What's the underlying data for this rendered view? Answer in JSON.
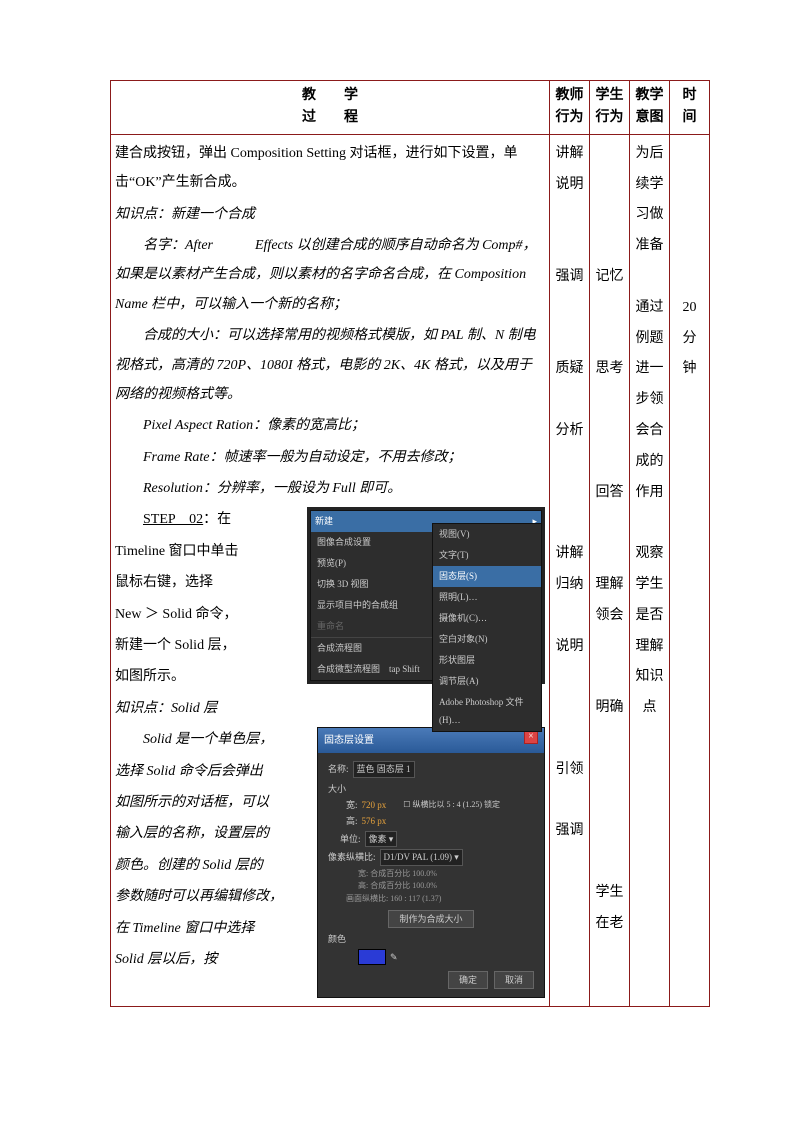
{
  "header": {
    "col1_line1": "教　　学",
    "col1_line2": "过　　程",
    "col2_line1": "教师",
    "col2_line2": "行为",
    "col3_line1": "学生",
    "col3_line2": "行为",
    "col4_line1": "教学",
    "col4_line2": "意图",
    "col5_line1": "时",
    "col5_line2": "间"
  },
  "process": {
    "p1": "建合成按钮，弹出 Composition Setting 对话框，进行如下设置，单击“OK”产生新合成。",
    "p2": "知识点：新建一个合成",
    "p3": "名字：After　　　Effects 以创建合成的顺序自动命名为 Comp#，如果是以素材产生合成，则以素材的名字命名合成，在 Composition Name 栏中，可以输入一个新的名称；",
    "p4": "合成的大小：可以选择常用的视频格式模版，如 PAL 制、N 制电视格式，高清的 720P、1080I 格式，电影的 2K、4K 格式，以及用于网络的视频格式等。",
    "p5": "Pixel Aspect Ration：像素的宽高比；",
    "p6": "Frame Rate：帧速率一般为自动设定，不用去修改；",
    "p7": "Resolution：分辨率，一般设为 Full 即可。",
    "step2_label": "STEP　02",
    "step2_after": "：在",
    "step2_l2": "Timeline 窗口中单击",
    "step2_l3": "鼠标右键，选择",
    "step2_l4": "New ＞ Solid 命令，",
    "step2_l5": "新建一个 Solid 层，",
    "step2_l6": "如图所示。",
    "p8": "知识点：Solid 层",
    "p9_l1": "Solid 是一个单色层，",
    "p9_l2": "选择 Solid 命令后会弹出",
    "p9_l3": "如图所示的对话框，可以",
    "p9_l4": "输入层的名称，设置层的",
    "p9_l5": "颜色。创建的 Solid 层的",
    "p9_l6": "参数随时可以再编辑修改，",
    "p9_l7": "在 Timeline 窗口中选择",
    "p9_l8": "Solid 层以后，按"
  },
  "teacher": [
    "讲解",
    "说明",
    "强调",
    "质疑",
    "分析",
    "讲解",
    "归纳",
    "说明",
    "引领",
    "强调"
  ],
  "student": [
    "记忆",
    "思考",
    "回答",
    "理解",
    "领会",
    "明确",
    "学生",
    "在老"
  ],
  "intent": {
    "g1": [
      "为后",
      "续学",
      "习做",
      "准备"
    ],
    "g2": [
      "通过",
      "例题",
      "进一",
      "步领",
      "会合",
      "成的",
      "作用"
    ],
    "g3": [
      "观察",
      "学生",
      "是否",
      "理解",
      "知识",
      "点"
    ]
  },
  "time": [
    "20",
    "分",
    "钟"
  ],
  "ss1": {
    "new": "新建",
    "view": "视图(V)",
    "compset": "图像合成设置",
    "text": "文字(T)",
    "preview": "预览(P)",
    "solid": "固态层(S)",
    "switch3d": "切换 3D 视图",
    "light": "照明(L)…",
    "showcomp": "显示项目中的合成组",
    "camera": "摄像机(C)…",
    "rename": "重命名",
    "null": "空白对象(N)",
    "shape": "形状图层",
    "flowchart": "合成流程图",
    "adjust": "调节层(A)",
    "miniflow": "合成微型流程图　tap Shift",
    "psd": "Adobe Photoshop 文件(H)…"
  },
  "ss2": {
    "title": "固态层设置",
    "name_l": "名称:",
    "name_v": "蓝色 固态层 1",
    "size_h": "大小",
    "w_l": "宽:",
    "w_v": "720 px",
    "lock": "纵横比以 5 : 4 (1.25) 锁定",
    "h_l": "高:",
    "h_v": "576 px",
    "unit_l": "单位:",
    "unit_v": "像素",
    "par_l": "像素纵横比:",
    "par_v": "D1/DV PAL (1.09)",
    "info1": "宽: 合成百分比 100.0%",
    "info2": "高: 合成百分比 100.0%",
    "info3": "画面纵横比: 160 : 117 (1.37)",
    "makecomp": "制作为合成大小",
    "color_l": "颜色",
    "ok": "确定",
    "cancel": "取消"
  }
}
